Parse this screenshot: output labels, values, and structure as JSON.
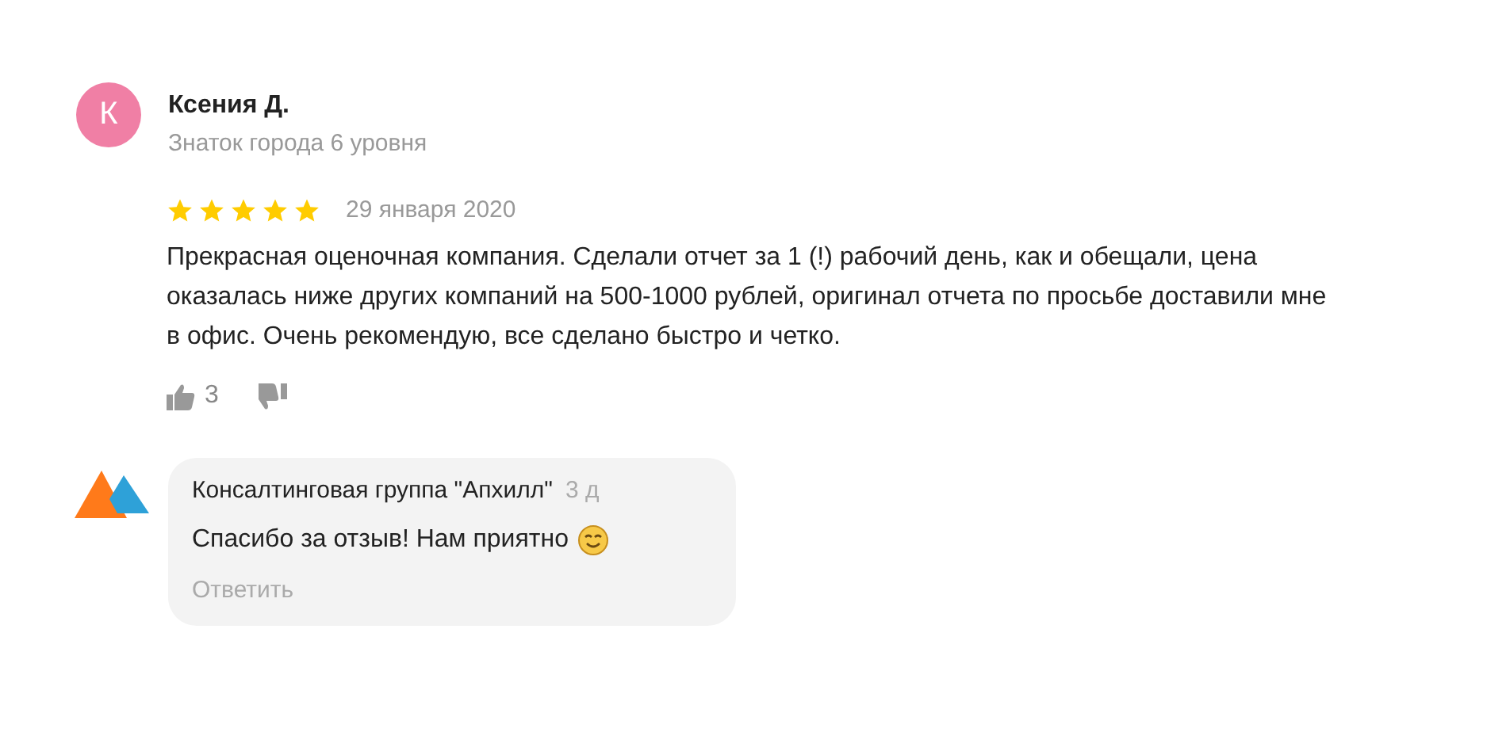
{
  "review": {
    "avatar_letter": "К",
    "author": "Ксения Д.",
    "author_level": "Знаток города 6 уровня",
    "stars": 5,
    "date": "29 января 2020",
    "text": "Прекрасная оценочная компания. Сделали отчет за 1 (!) рабочий день, как и обещали, цена оказалась ниже других компаний на 500-1000 рублей, оригинал отчета по просьбе доставили мне в офис. Очень рекомендую, все сделано быстро и четко.",
    "likes": "3"
  },
  "reply": {
    "author": "Консалтинговая группа \"Апхилл\"",
    "time": "3 д",
    "text": "Спасибо за отзыв! Нам приятно",
    "action": "Ответить"
  }
}
